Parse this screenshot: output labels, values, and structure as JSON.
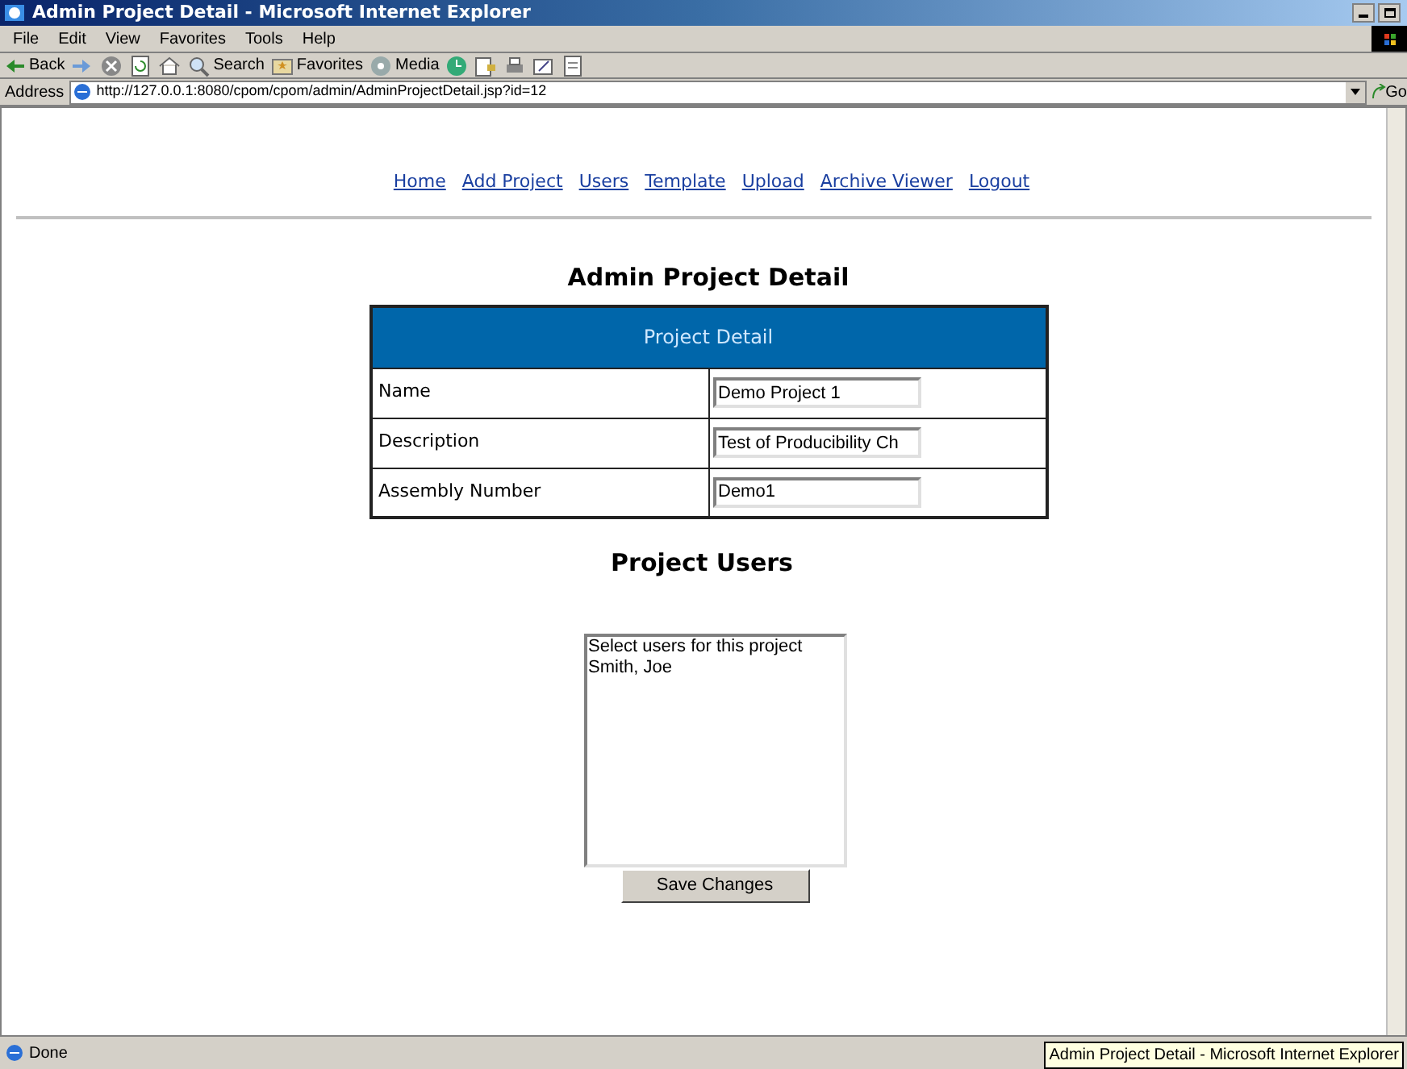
{
  "window": {
    "title": "Admin Project Detail - Microsoft Internet Explorer"
  },
  "menu": [
    "File",
    "Edit",
    "View",
    "Favorites",
    "Tools",
    "Help"
  ],
  "toolbar": [
    {
      "kind": "back",
      "label": "Back"
    },
    {
      "kind": "forward"
    },
    {
      "kind": "stop"
    },
    {
      "kind": "refresh"
    },
    {
      "kind": "home"
    },
    {
      "kind": "search",
      "label": "Search"
    },
    {
      "kind": "favorites",
      "label": "Favorites"
    },
    {
      "kind": "media",
      "label": "Media"
    },
    {
      "kind": "history"
    },
    {
      "kind": "mail"
    },
    {
      "kind": "print"
    },
    {
      "kind": "edit"
    },
    {
      "kind": "discuss"
    }
  ],
  "address": {
    "label": "Address",
    "url": "http://127.0.0.1:8080/cpom/cpom/admin/AdminProjectDetail.jsp?id=12",
    "go": "Go"
  },
  "nav": [
    "Home",
    "Add Project",
    "Users",
    "Template",
    "Upload",
    "Archive Viewer",
    "Logout"
  ],
  "heading": "Admin Project Detail",
  "table": {
    "header": "Project Detail",
    "rows": [
      {
        "label": "Name",
        "value": "Demo Project 1"
      },
      {
        "label": "Description",
        "value": "Test of Producibility Ch"
      },
      {
        "label": "Assembly Number",
        "value": "Demo1"
      }
    ]
  },
  "users_heading": "Project Users",
  "users_list": [
    "Select users for this project",
    "Smith, Joe"
  ],
  "save_button": "Save Changes",
  "status_bar": {
    "text": "Done",
    "tooltip": "Admin Project Detail - Microsoft Internet Explorer"
  }
}
